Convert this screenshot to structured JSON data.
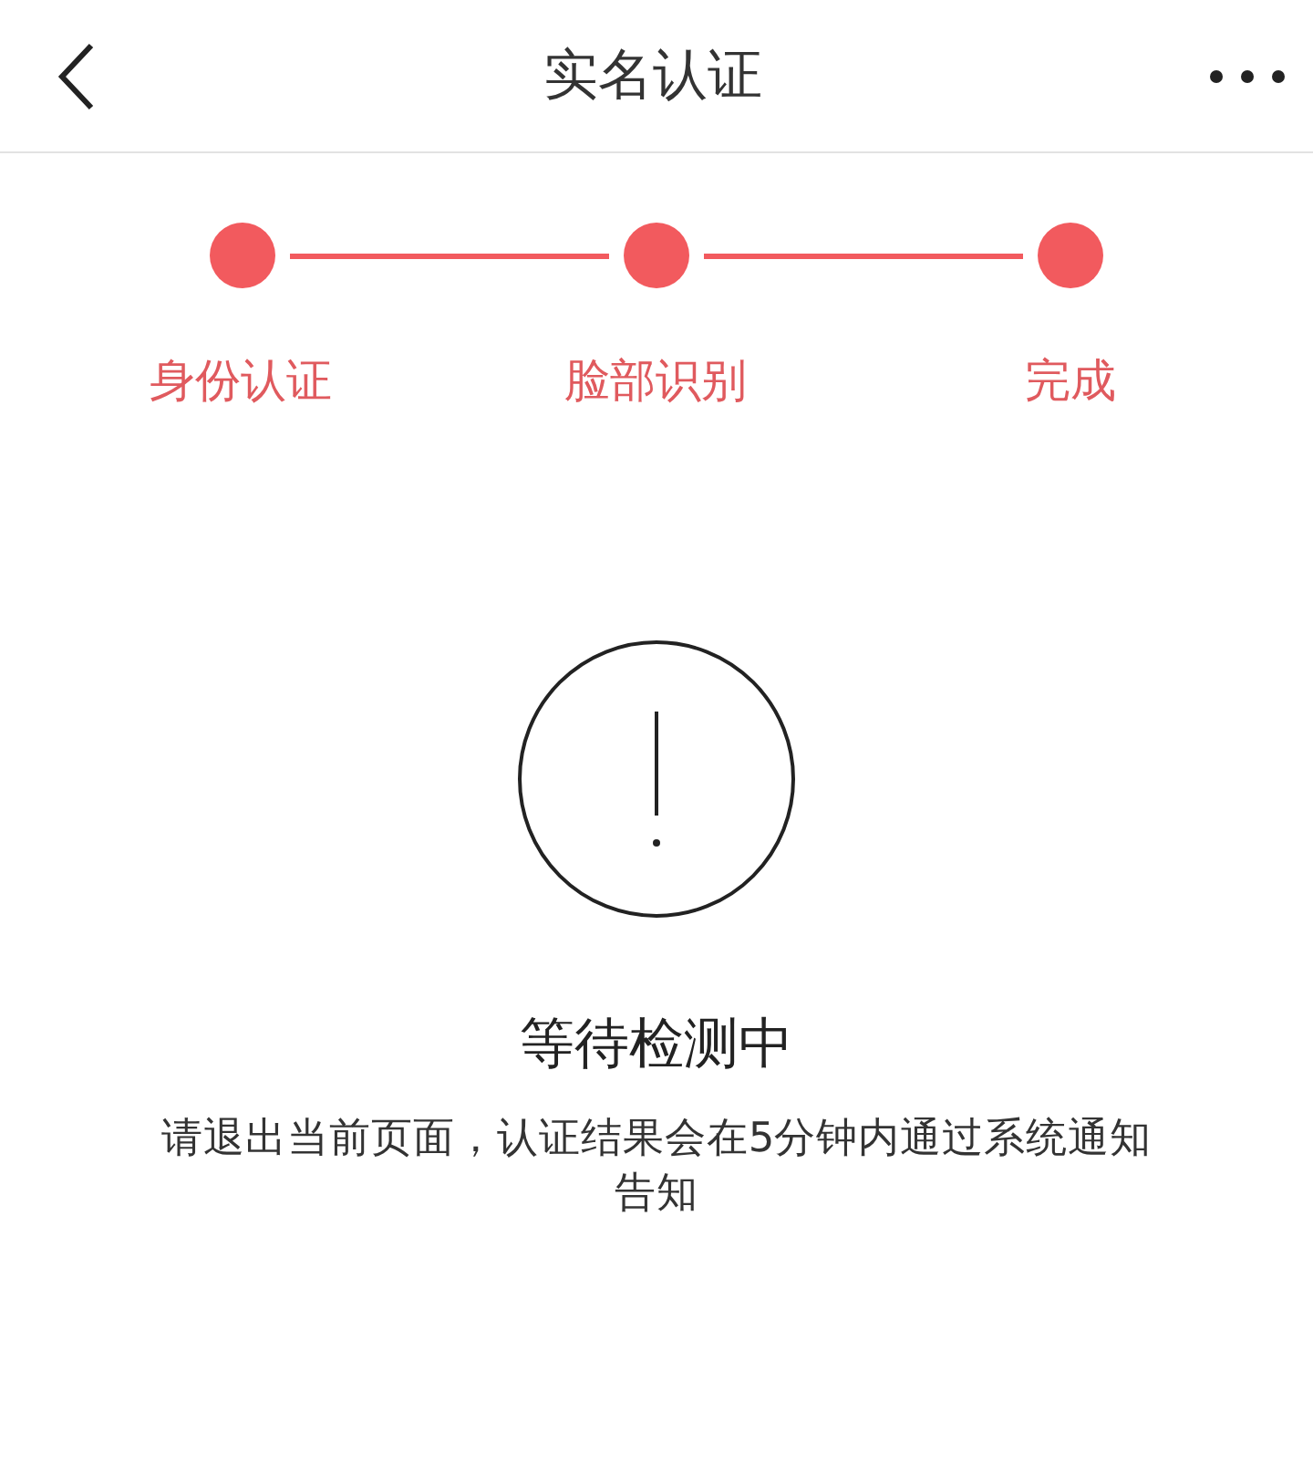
{
  "header": {
    "title": "实名认证"
  },
  "steps": [
    {
      "label": "身份认证",
      "done": true
    },
    {
      "label": "脸部识别",
      "done": true
    },
    {
      "label": "完成",
      "done": true
    }
  ],
  "status": {
    "title": "等待检测中",
    "message": "请退出当前页面，认证结果会在5分钟内通过系统通知告知"
  }
}
